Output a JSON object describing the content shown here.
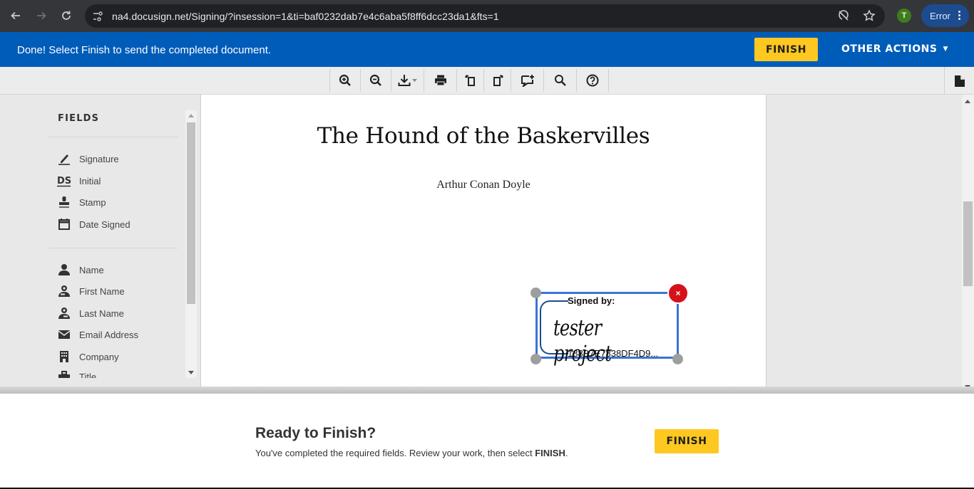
{
  "browser": {
    "url": "na4.docusign.net/Signing/?insession=1&ti=baf0232dab7e4c6aba5f8ff6dcc23da1&fts=1",
    "profile_initial": "T",
    "error_chip_label": "Error"
  },
  "banner": {
    "message": "Done! Select Finish to send the completed document.",
    "finish_label": "FINISH",
    "other_actions_label": "OTHER ACTIONS",
    "colors": {
      "banner": "#005cb9",
      "finish_button": "#ffc820"
    }
  },
  "toolbar": {
    "tools": [
      {
        "name": "zoom-in",
        "icon": "zoom-in-icon"
      },
      {
        "name": "zoom-out",
        "icon": "zoom-out-icon"
      },
      {
        "name": "download",
        "icon": "download-icon"
      },
      {
        "name": "print",
        "icon": "print-icon"
      },
      {
        "name": "rotate-left",
        "icon": "rotate-left-icon"
      },
      {
        "name": "rotate-right",
        "icon": "rotate-right-icon"
      },
      {
        "name": "add-comment",
        "icon": "add-comment-icon"
      },
      {
        "name": "search",
        "icon": "search-icon"
      },
      {
        "name": "help",
        "icon": "help-icon"
      }
    ],
    "document_panel_icon": "document-icon"
  },
  "fields_panel": {
    "title": "FIELDS",
    "group1": [
      {
        "label": "Signature",
        "icon": "signature-pen-icon"
      },
      {
        "label": "Initial",
        "icon": "initial-ds-icon"
      },
      {
        "label": "Stamp",
        "icon": "stamp-icon"
      },
      {
        "label": "Date Signed",
        "icon": "calendar-icon"
      }
    ],
    "group2": [
      {
        "label": "Name",
        "icon": "person-icon"
      },
      {
        "label": "First Name",
        "icon": "person-first-icon"
      },
      {
        "label": "Last Name",
        "icon": "person-last-icon"
      },
      {
        "label": "Email Address",
        "icon": "envelope-icon"
      },
      {
        "label": "Company",
        "icon": "building-icon"
      },
      {
        "label": "Title",
        "icon": "title-icon"
      }
    ]
  },
  "document": {
    "title": "The Hound of the Baskervilles",
    "author": "Arthur Conan Doyle",
    "signature": {
      "signed_by_label": "Signed by:",
      "signer_name": "tester project",
      "hash": "188B7E7838DF4D9...",
      "remove_symbol": "×"
    }
  },
  "finish_panel": {
    "title": "Ready to Finish?",
    "message_prefix": "You've completed the required fields. Review your work, then select ",
    "message_bold": "FINISH",
    "message_suffix": ".",
    "finish_label": "FINISH"
  }
}
